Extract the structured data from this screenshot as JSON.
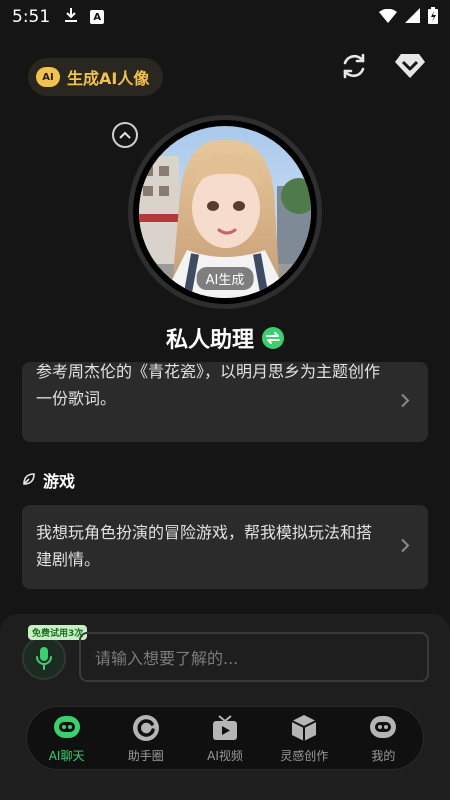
{
  "status_bar": {
    "time": "5:51"
  },
  "header": {
    "generate_label": "生成AI人像",
    "ai_badge": "AI"
  },
  "avatar": {
    "tag": "AI生成"
  },
  "assistant": {
    "name": "私人助理"
  },
  "cards": {
    "partial_text": "参考周杰伦的《青花瓷》，以明月思乡为主题创作一份歌词。",
    "section_title": "游戏",
    "game_text": "我想玩角色扮演的冒险游戏，帮我模拟玩法和搭建剧情。"
  },
  "input": {
    "free_badge": "免费试用3次",
    "placeholder": "请输入想要了解的..."
  },
  "tabs": [
    {
      "label": "AI聊天",
      "icon": "robot-chat-icon",
      "active": true
    },
    {
      "label": "助手圈",
      "icon": "circle-icon",
      "active": false
    },
    {
      "label": "AI视频",
      "icon": "video-icon",
      "active": false
    },
    {
      "label": "灵感创作",
      "icon": "cube-icon",
      "active": false
    },
    {
      "label": "我的",
      "icon": "profile-robot-icon",
      "active": false
    }
  ],
  "colors": {
    "accent": "#3ccf6e",
    "gold": "#f2c24e",
    "background": "#151515",
    "card": "#2b2b2b"
  }
}
